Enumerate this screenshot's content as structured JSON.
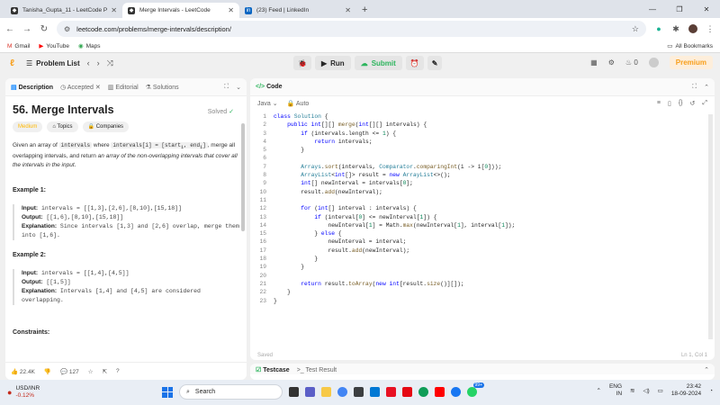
{
  "browser": {
    "tabs": [
      {
        "title": "Tanisha_Gupta_11 - LeetCode P",
        "fav": "#f89f1b",
        "favicon": "leetcode-icon"
      },
      {
        "title": "Merge Intervals - LeetCode",
        "fav": "#f89f1b",
        "favicon": "leetcode-icon"
      },
      {
        "title": "(23) Feed | LinkedIn",
        "fav": "#0a66c2",
        "favicon": "in"
      }
    ],
    "url": "leetcode.com/problems/merge-intervals/description/",
    "bookmarks": [
      "Gmail",
      "YouTube",
      "Maps"
    ],
    "all_bookmarks": "All Bookmarks"
  },
  "lcnav": {
    "problem_list": "Problem List",
    "run": "Run",
    "submit": "Submit",
    "streak": "0",
    "premium": "Premium"
  },
  "left": {
    "tabs": [
      "Description",
      "Accepted",
      "Editorial",
      "Solutions"
    ],
    "title": "56. Merge Intervals",
    "solved": "Solved",
    "tags": [
      "Medium",
      "Topics",
      "Companies"
    ],
    "desc1": "Given an array of ",
    "desc_code1": "intervals",
    "desc2": " where ",
    "desc_code2": "intervals[i] = [start",
    "desc_sub1": "i",
    "desc_code3": ", end",
    "desc_sub2": "i",
    "desc_code4": "]",
    "desc3": ", merge all overlapping intervals, and return ",
    "desc4": "an array of the non-overlapping intervals that cover all the intervals in the input",
    "desc5": ".",
    "examples": [
      {
        "heading": "Example 1:",
        "input_label": "Input:",
        "input": "intervals = [[1,3],[2,6],[8,10],[15,18]]",
        "output_label": "Output:",
        "output": "[[1,6],[8,10],[15,18]]",
        "expl_label": "Explanation:",
        "explanation": "Since intervals [1,3] and [2,6] overlap, merge them into [1,6]."
      },
      {
        "heading": "Example 2:",
        "input_label": "Input:",
        "input": "intervals = [[1,4],[4,5]]",
        "output_label": "Output:",
        "output": "[[1,5]]",
        "expl_label": "Explanation:",
        "explanation": "Intervals [1,4] and [4,5] are considered overlapping."
      }
    ],
    "constraints": "Constraints:",
    "likes": "22.4K",
    "comments": "127"
  },
  "code": {
    "title": "Code",
    "language": "Java",
    "auto": "Auto",
    "saved": "Saved",
    "position": "Ln 1, Col 1"
  },
  "bottom": {
    "testcase": "Testcase",
    "test_result": "Test Result"
  },
  "taskbar": {
    "stock_name": "USD/INR",
    "stock_change": "-0.12%",
    "search": "Search",
    "lang1": "ENG",
    "lang2": "IN",
    "time": "23:42",
    "date": "18-09-2024",
    "badge": "99+"
  }
}
